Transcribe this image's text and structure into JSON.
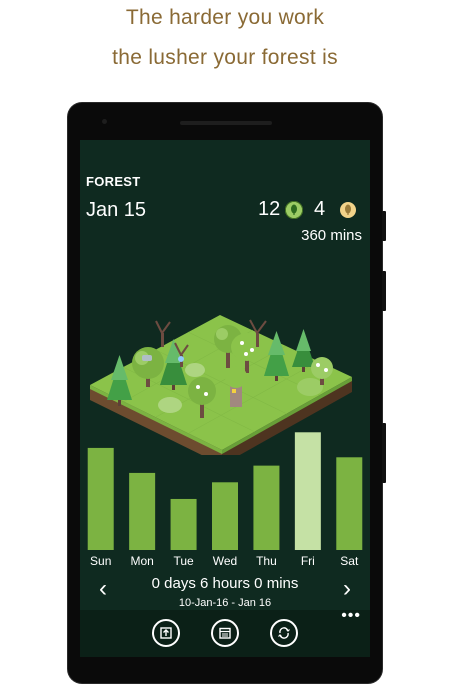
{
  "tagline": {
    "line1": "The harder you work",
    "line2": "the lusher your forest is"
  },
  "screen": {
    "title": "FOREST",
    "date": "Jan 15",
    "trees_count": "12",
    "trees_icon": "green-tree-coin-icon",
    "coins_count": "4",
    "coins_icon": "gold-tree-coin-icon",
    "minutes": "360 mins",
    "summary": "0 days 6 hours 0 mins",
    "range": "10-Jan-16 - Jan 16",
    "prev_arrow": "‹",
    "next_arrow": "›",
    "more": "•••",
    "appbar_icons": [
      "export-icon",
      "calendar-icon",
      "sync-icon"
    ]
  },
  "colors": {
    "background": "#0f2a20",
    "bar": "#7cb342",
    "bar_highlight": "#c5e1a5",
    "tagline": "#8a6a35"
  },
  "chart_data": {
    "type": "bar",
    "categories": [
      "Sun",
      "Mon",
      "Tue",
      "Wed",
      "Thu",
      "Fri",
      "Sat"
    ],
    "values": [
      98,
      74,
      49,
      65,
      81,
      113,
      89
    ],
    "highlight": "Fri",
    "ylim": [
      0,
      120
    ],
    "grid": false,
    "xlabel": "",
    "ylabel": ""
  }
}
